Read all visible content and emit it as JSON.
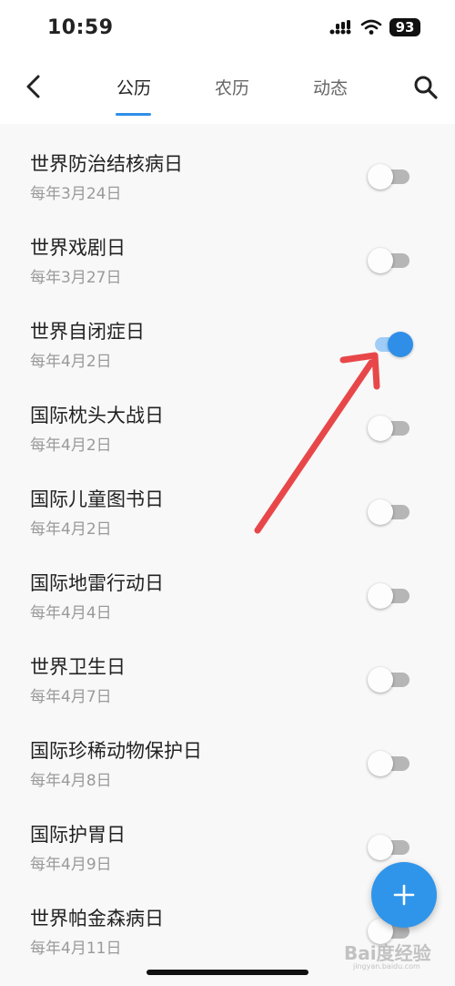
{
  "status_bar": {
    "time": "10:59",
    "battery": "93"
  },
  "nav": {
    "tabs": [
      {
        "label": "公历",
        "active": true
      },
      {
        "label": "农历",
        "active": false
      },
      {
        "label": "动态",
        "active": false
      }
    ]
  },
  "events": [
    {
      "title": "世界防治结核病日",
      "date": "每年3月24日",
      "enabled": false
    },
    {
      "title": "世界戏剧日",
      "date": "每年3月27日",
      "enabled": false
    },
    {
      "title": "世界自闭症日",
      "date": "每年4月2日",
      "enabled": true
    },
    {
      "title": "国际枕头大战日",
      "date": "每年4月2日",
      "enabled": false
    },
    {
      "title": "国际儿童图书日",
      "date": "每年4月2日",
      "enabled": false
    },
    {
      "title": "国际地雷行动日",
      "date": "每年4月4日",
      "enabled": false
    },
    {
      "title": "世界卫生日",
      "date": "每年4月7日",
      "enabled": false
    },
    {
      "title": "国际珍稀动物保护日",
      "date": "每年4月8日",
      "enabled": false
    },
    {
      "title": "国际护胃日",
      "date": "每年4月9日",
      "enabled": false
    },
    {
      "title": "世界帕金森病日",
      "date": "每年4月11日",
      "enabled": false
    }
  ],
  "watermark": {
    "text": "Bai度经验",
    "sub": "jingyan.baidu.com"
  },
  "colors": {
    "accent": "#2f8fe8",
    "arrow": "#e8474a"
  },
  "icons": {
    "back": "back-arrow-icon",
    "search": "search-icon",
    "add": "plus-icon"
  }
}
